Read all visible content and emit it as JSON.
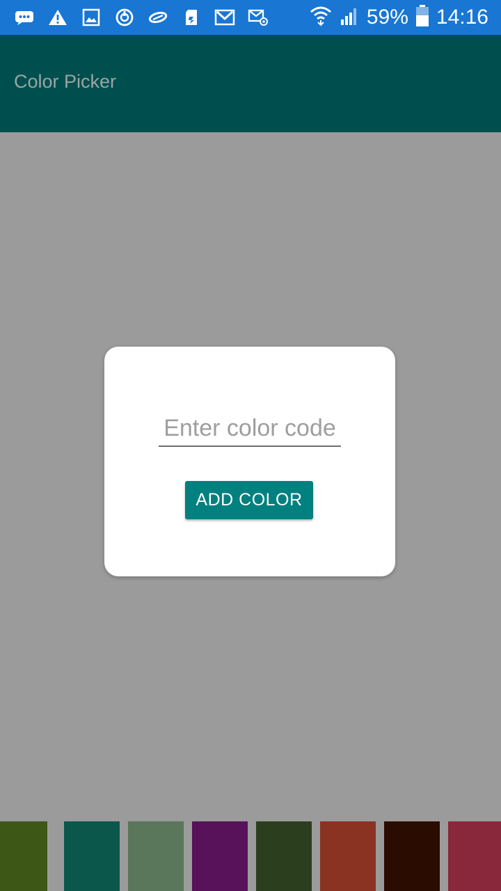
{
  "status_bar": {
    "icons": [
      "messages-icon",
      "warning-icon",
      "image-icon",
      "sync-icon",
      "link-icon",
      "sd-card-icon",
      "gmail-icon",
      "email-icon"
    ],
    "battery_percent": "59%",
    "time": "14:16",
    "color": "#1976d2"
  },
  "app_bar": {
    "title": "Color Picker",
    "color": "#004f4f"
  },
  "dialog": {
    "input_placeholder": "Enter color code",
    "input_value": "",
    "button_label": "ADD COLOR",
    "button_color": "#00807e"
  },
  "swatches": [
    "#3d5716",
    "#0b574b",
    "#5a765b",
    "#57125a",
    "#2b3e1e",
    "#8a3322",
    "#2a0c00",
    "#88283a"
  ]
}
